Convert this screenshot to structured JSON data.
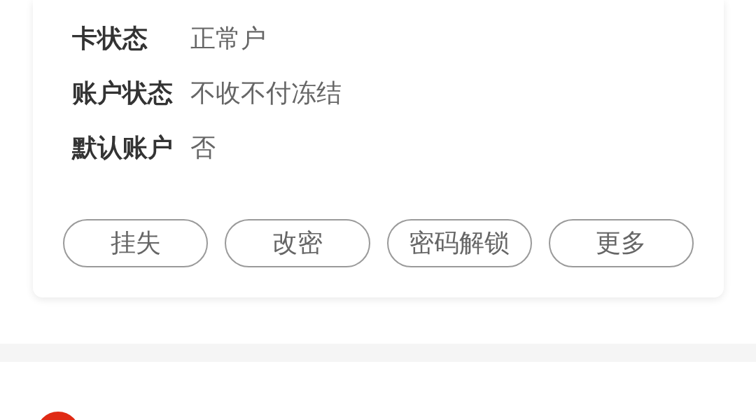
{
  "account_card": {
    "fields": [
      {
        "label": "卡状态",
        "value": "正常户"
      },
      {
        "label": "账户状态",
        "value": "不收不付冻结"
      },
      {
        "label": "默认账户",
        "value": "否"
      }
    ],
    "buttons": [
      "挂失",
      "改密",
      "密码解锁",
      "更多"
    ]
  }
}
